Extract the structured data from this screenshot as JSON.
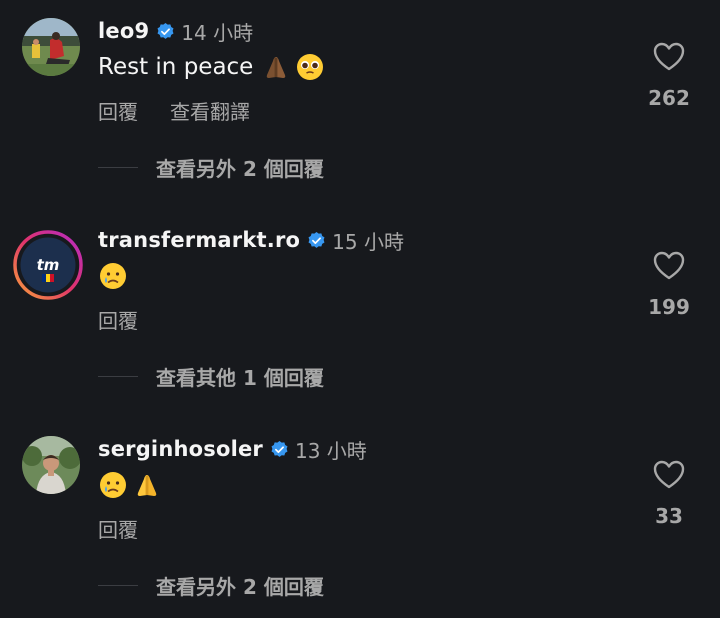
{
  "comments": [
    {
      "username": "leo9",
      "time": "14 小時",
      "text": "Rest in peace",
      "emojis": [
        "folded-hands-dark",
        "pleading-face"
      ],
      "actions": {
        "reply": "回覆",
        "translate": "查看翻譯"
      },
      "likes": "262",
      "more_replies": "查看另外 2 個回覆"
    },
    {
      "username": "transfermarkt.ro",
      "time": "15 小時",
      "text": "",
      "emojis": [
        "crying-face"
      ],
      "avatar_text": "tm",
      "actions": {
        "reply": "回覆"
      },
      "likes": "199",
      "more_replies": "查看其他 1 個回覆"
    },
    {
      "username": "serginhosoler",
      "time": "13 小時",
      "text": "",
      "emojis": [
        "crying-face",
        "folded-hands"
      ],
      "actions": {
        "reply": "回覆"
      },
      "likes": "33",
      "more_replies": "查看另外 2 個回覆"
    }
  ],
  "colors": {
    "background": "#17191d",
    "text_primary": "#f5f5f5",
    "text_secondary": "#a8a8a8",
    "verified_blue": "#3797f0"
  }
}
